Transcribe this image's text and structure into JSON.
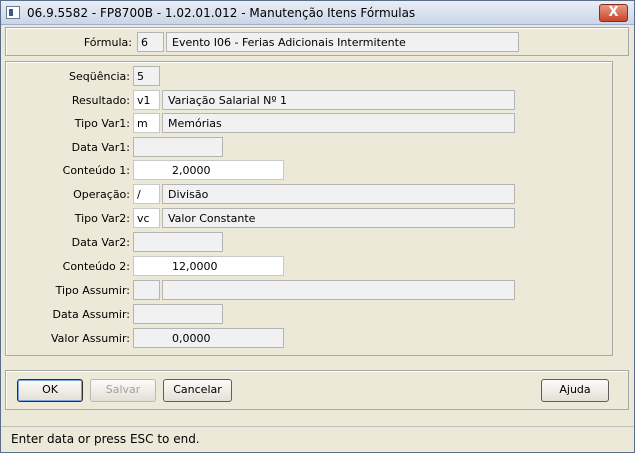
{
  "window": {
    "title": "06.9.5582 - FP8700B - 1.02.01.012 - Manutenção Itens Fórmulas",
    "close_glyph": "X"
  },
  "header": {
    "formula_label": "Fórmula:",
    "formula_code": "6",
    "formula_desc": "Evento I06 - Ferias Adicionais Intermitente"
  },
  "form": {
    "sequencia_label": "Seqüência:",
    "sequencia_value": "5",
    "resultado_label": "Resultado:",
    "resultado_code": "v1",
    "resultado_desc": "Variação Salarial Nº 1",
    "tipo_var1_label": "Tipo Var1:",
    "tipo_var1_code": "m",
    "tipo_var1_desc": "Memórias",
    "data_var1_label": "Data Var1:",
    "data_var1_value": "",
    "conteudo1_label": "Conteúdo 1:",
    "conteudo1_value": "2,0000",
    "operacao_label": "Operação:",
    "operacao_code": "/",
    "operacao_desc": "Divisão",
    "tipo_var2_label": "Tipo Var2:",
    "tipo_var2_code": "vc",
    "tipo_var2_desc": "Valor Constante",
    "data_var2_label": "Data Var2:",
    "data_var2_value": "",
    "conteudo2_label": "Conteúdo 2:",
    "conteudo2_value": "12,0000",
    "tipo_assumir_label": "Tipo Assumir:",
    "tipo_assumir_code": "",
    "tipo_assumir_desc": "",
    "data_assumir_label": "Data Assumir:",
    "data_assumir_value": "",
    "valor_assumir_label": "Valor Assumir:",
    "valor_assumir_value": "0,0000"
  },
  "buttons": {
    "ok_label": "OK",
    "salvar_label": "Salvar",
    "cancelar_label": "Cancelar",
    "ajuda_label": "Ajuda"
  },
  "status": {
    "text": "Enter data or press ESC to end."
  }
}
